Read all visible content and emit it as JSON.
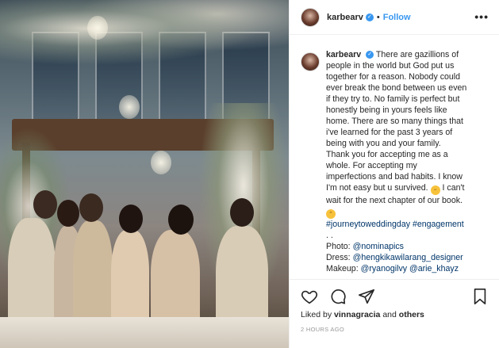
{
  "header": {
    "username": "karbearv",
    "separator": "•",
    "follow_label": "Follow",
    "more": "•••"
  },
  "caption": {
    "username": "karbearv",
    "lines": [
      "There are gazillions of",
      "people in the world but God put us",
      "together for a reason. Nobody could",
      "ever break the bond between us even",
      "if they try to. No family is perfect but",
      "honestly being in yours feels like",
      "home. There are so many things that",
      "i've learned for the past 3 years of",
      "being with you and your family.",
      "Thank you for accepting me as a",
      "whole. For accepting my",
      "imperfections and bad habits. I know",
      "I'm not easy but u survived."
    ],
    "after_emoji": "I can't",
    "line_wait": "wait for the next chapter of our book.",
    "hashtags": "#journeytoweddingday #engagement",
    "dots": ". .",
    "photo_label": "Photo:",
    "photo_handle": "@nominapics",
    "dress_label": "Dress:",
    "dress_handle": "@hengkikawilarang_designer",
    "makeup_label": "Makeup:",
    "makeup_handle1": "@ryanogilvy",
    "makeup_handle2": "@arie_khayz"
  },
  "actions": {
    "liked_prefix": "Liked by",
    "liked_user": "vinnagracia",
    "liked_suffix": "and",
    "liked_others": "others",
    "timestamp": "2 HOURS AGO"
  },
  "icons": {
    "verified": "verified-badge-icon",
    "like": "heart-icon",
    "comment": "comment-icon",
    "share": "share-icon",
    "save": "bookmark-icon"
  },
  "colors": {
    "accent": "#3897f0",
    "text": "#262626",
    "muted": "#999999",
    "link": "#003569"
  }
}
